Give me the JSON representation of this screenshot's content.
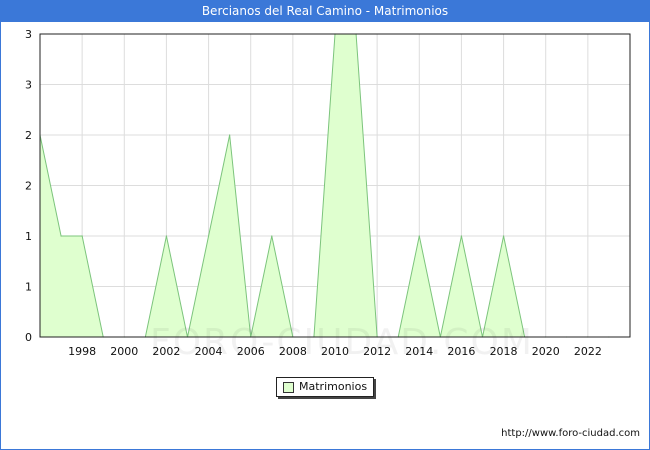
{
  "title": "Bercianos del Real Camino - Matrimonios",
  "legend_label": "Matrimonios",
  "footer": "http://www.foro-ciudad.com",
  "watermark": "FORO-CIUDAD.COM",
  "colors": {
    "fill": "#dfffcf",
    "line": "#7cc47c",
    "header": "#3b78d8"
  },
  "chart_data": {
    "type": "area",
    "series": [
      {
        "name": "Matrimonios",
        "x": [
          1996,
          1997,
          1998,
          1999,
          2000,
          2001,
          2002,
          2003,
          2004,
          2005,
          2006,
          2007,
          2008,
          2009,
          2010,
          2011,
          2012,
          2013,
          2014,
          2015,
          2016,
          2017,
          2018,
          2019,
          2020,
          2021,
          2022,
          2023
        ],
        "values": [
          2,
          1,
          1,
          0,
          0,
          0,
          1,
          0,
          1,
          2,
          0,
          1,
          0,
          0,
          3,
          3,
          0,
          0,
          1,
          0,
          1,
          0,
          1,
          0,
          0,
          0,
          0,
          0
        ]
      }
    ],
    "xlim": [
      1996,
      2024
    ],
    "ylim": [
      0,
      3
    ],
    "x_ticks": [
      "1998",
      "2000",
      "2002",
      "2004",
      "2006",
      "2008",
      "2010",
      "2012",
      "2014",
      "2016",
      "2018",
      "2020",
      "2022"
    ],
    "y_ticks": [
      "0",
      "1",
      "1",
      "2",
      "2",
      "3",
      "3"
    ],
    "grid": true,
    "legend_position": "bottom-center"
  }
}
